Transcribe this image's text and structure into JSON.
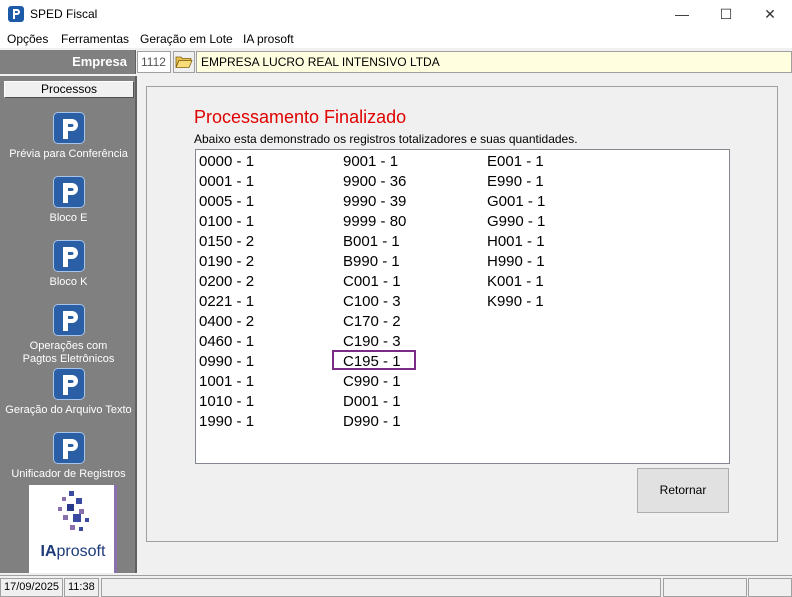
{
  "window": {
    "title": "SPED Fiscal"
  },
  "menu": [
    "Opções",
    "Ferramentas",
    "Geração em Lote",
    "IA prosoft"
  ],
  "empresa": {
    "label": "Empresa",
    "code": "1112",
    "name": "EMPRESA LUCRO REAL INTENSIVO LTDA"
  },
  "sidebar": {
    "header": "Processos",
    "items": [
      {
        "label_1": "Prévia para Conferência",
        "label_2": ""
      },
      {
        "label_1": "Bloco E",
        "label_2": ""
      },
      {
        "label_1": "Bloco K",
        "label_2": ""
      },
      {
        "label_1": "Operações com",
        "label_2": "Pagtos Eletrônicos"
      },
      {
        "label_1": "Geração do Arquivo Texto",
        "label_2": ""
      },
      {
        "label_1": "Unificador de Registros",
        "label_2": ""
      }
    ],
    "logo": {
      "part_a": "IA",
      "part_b": "prosoft"
    }
  },
  "panel": {
    "title": "Processamento Finalizado",
    "subtitle": "Abaixo esta demonstrado os registros totalizadores e suas quantidades.",
    "columns": [
      [
        "0000 - 1",
        "0001 - 1",
        "0005 - 1",
        "0100 - 1",
        "0150 - 2",
        "0190 - 2",
        "0200 - 2",
        "0221 - 1",
        "0400 - 2",
        "0460 - 1",
        "0990 - 1",
        "1001 - 1",
        "1010 - 1",
        "1990 - 1"
      ],
      [
        "9001 - 1",
        "9900 - 36",
        "9990 - 39",
        "9999 - 80",
        "B001 - 1",
        "B990 - 1",
        "C001 - 1",
        "C100 - 3",
        "C170 - 2",
        "C190 - 3",
        "C195 - 1",
        "C990 - 1",
        "D001 - 1",
        "D990 - 1"
      ],
      [
        "E001 - 1",
        "E990 - 1",
        "G001 - 1",
        "G990 - 1",
        "H001 - 1",
        "H990 - 1",
        "K001 - 1",
        "K990 - 1"
      ]
    ],
    "button_label": "Retornar"
  },
  "status": {
    "date": "17/09/2025",
    "time": "11:38"
  },
  "colors": {
    "title_red": "#e00000",
    "highlight": "#7b2a86",
    "sidebar_bg": "#808080",
    "empresa_bg": "#ffffe0"
  },
  "icons": [
    "app-icon",
    "minimize-icon",
    "maximize-icon",
    "close-icon",
    "folder-open-icon",
    "prosoft-p-icon"
  ]
}
